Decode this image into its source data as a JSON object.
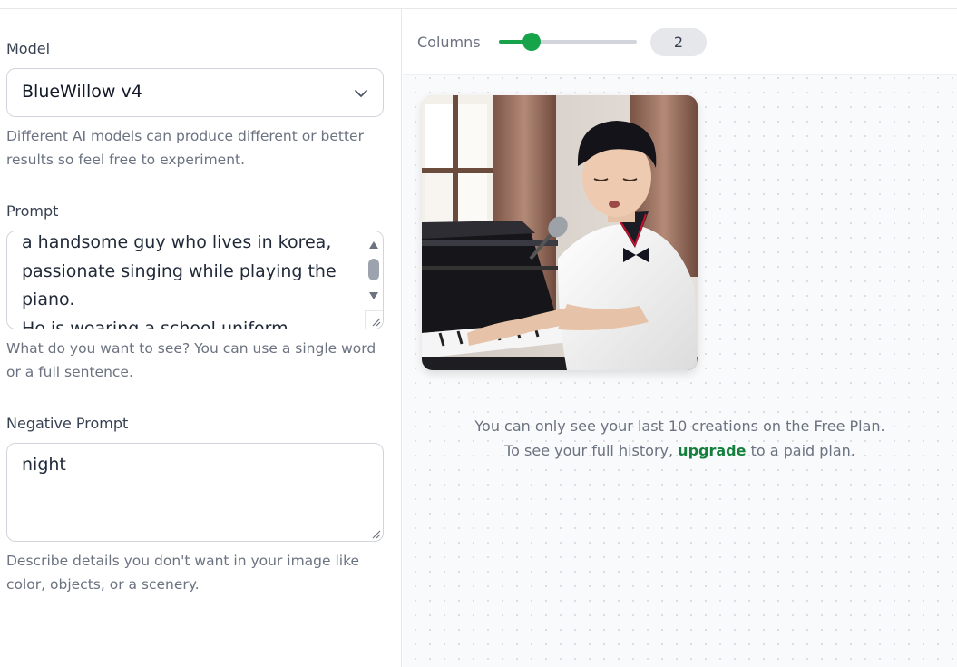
{
  "sidebar": {
    "model": {
      "label": "Model",
      "selected": "BlueWillow v4",
      "help": "Different AI models can produce different or better results so feel free to experiment."
    },
    "prompt": {
      "label": "Prompt",
      "value": "a handsome guy who lives in korea,\npassionate singing while playing the\npiano.\nHe is wearing a school uniform",
      "help": "What do you want to see? You can use a single word or a full sentence."
    },
    "negative_prompt": {
      "label": "Negative Prompt",
      "value": "night",
      "help": "Describe details you don't want in your image like color, objects, or a scenery."
    }
  },
  "toolbar": {
    "columns_label": "Columns",
    "columns_value": "2",
    "columns_slider_fraction": 0.24
  },
  "notice": {
    "line1": "You can only see your last 10 creations on the Free Plan.",
    "line2_prefix": "To see your full history,",
    "upgrade_link": "upgrade",
    "line2_suffix": "to a paid plan."
  },
  "colors": {
    "accent": "#16a34a",
    "link": "#15803d",
    "muted_text": "#6b7280",
    "border": "#d1d5db"
  },
  "icons": [
    "chevron-down-icon",
    "scroll-up-icon",
    "scroll-down-icon",
    "resize-grip-icon"
  ]
}
